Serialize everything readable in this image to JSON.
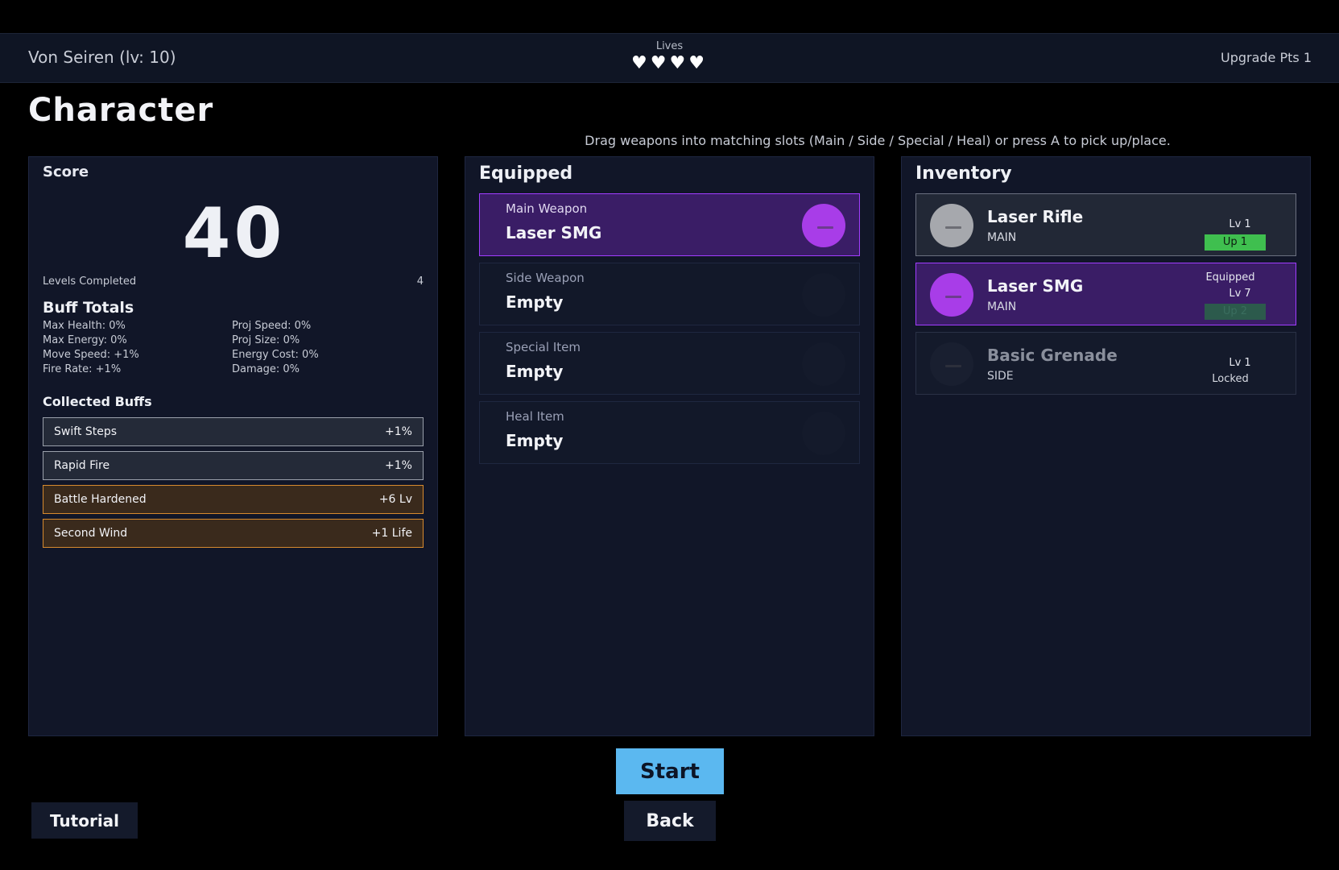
{
  "header": {
    "player": "Von Seiren (lv: 10)",
    "lives_label": "Lives",
    "hearts": "♥♥♥♥",
    "upgrade_points": "Upgrade Pts 1"
  },
  "page_title": "Character",
  "hint": "Drag weapons into matching slots (Main / Side / Special / Heal) or press A to pick up/place.",
  "score": {
    "label": "Score",
    "value": "40",
    "levels_label": "Levels Completed",
    "levels_value": "4",
    "buff_totals_title": "Buff Totals",
    "buff_totals": [
      "Max Health: 0%",
      "Proj Speed: 0%",
      "Max Energy: 0%",
      "Proj Size: 0%",
      "Move Speed: +1%",
      "Energy Cost: 0%",
      "Fire Rate: +1%",
      "Damage: 0%"
    ],
    "collected_title": "Collected Buffs",
    "collected": [
      {
        "name": "Swift Steps",
        "value": "+1%"
      },
      {
        "name": "Rapid Fire",
        "value": "+1%"
      },
      {
        "name": "Battle Hardened",
        "value": "+6 Lv"
      },
      {
        "name": "Second Wind",
        "value": "+1 Life"
      }
    ]
  },
  "equipped": {
    "title": "Equipped",
    "slots": [
      {
        "label": "Main Weapon",
        "value": "Laser SMG"
      },
      {
        "label": "Side Weapon",
        "value": "Empty"
      },
      {
        "label": "Special Item",
        "value": "Empty"
      },
      {
        "label": "Heal Item",
        "value": "Empty"
      }
    ]
  },
  "inventory": {
    "title": "Inventory",
    "items": [
      {
        "name": "Laser Rifle",
        "type": "MAIN",
        "level": "Lv 1",
        "upgrade": "Up 1"
      },
      {
        "name": "Laser SMG",
        "type": "MAIN",
        "status": "Equipped",
        "level": "Lv 7",
        "upgrade": "Up 2"
      },
      {
        "name": "Basic Grenade",
        "type": "SIDE",
        "level": "Lv 1",
        "status": "Locked"
      }
    ]
  },
  "buttons": {
    "start": "Start",
    "back": "Back",
    "tutorial": "Tutorial"
  },
  "colors": {
    "accent_purple": "#a83de8",
    "start_blue": "#5bb8f0",
    "upgrade_green": "#3fbf4f",
    "gold_border": "#d68a2e"
  }
}
